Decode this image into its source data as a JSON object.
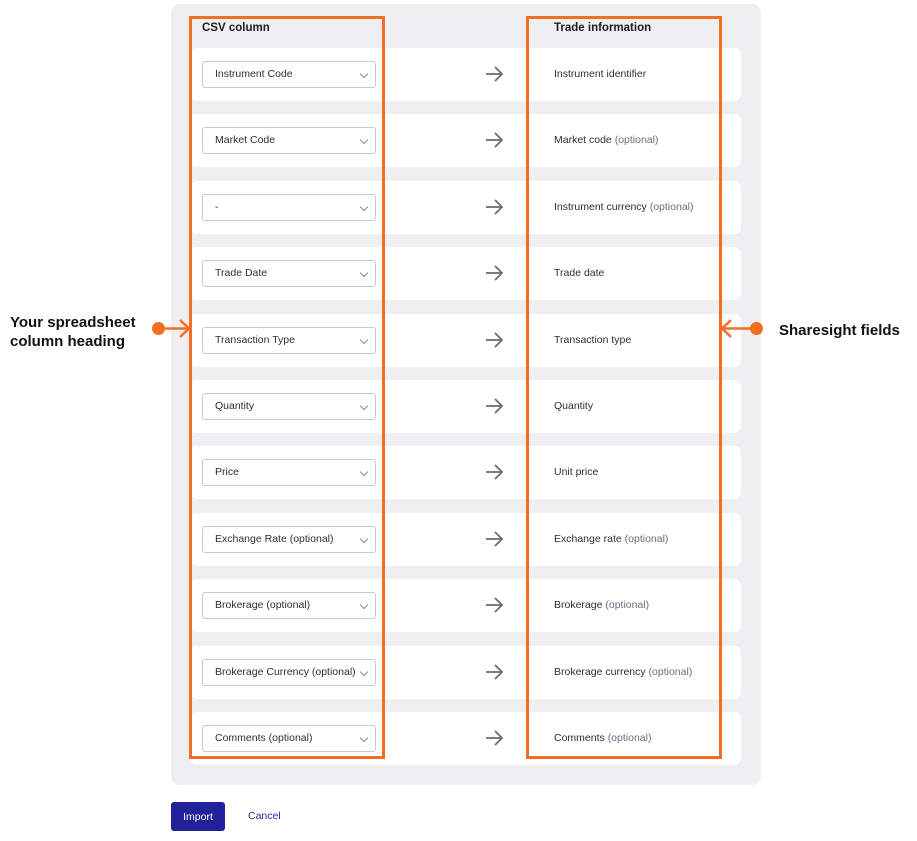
{
  "headers": {
    "csv_column": "CSV column",
    "trade_information": "Trade information"
  },
  "rows": [
    {
      "csv_value": "Instrument Code",
      "field": "Instrument identifier",
      "optional": ""
    },
    {
      "csv_value": "Market Code",
      "field": "Market code",
      "optional": "(optional)"
    },
    {
      "csv_value": "-",
      "field": "Instrument currency",
      "optional": "(optional)"
    },
    {
      "csv_value": "Trade Date",
      "field": "Trade date",
      "optional": ""
    },
    {
      "csv_value": "Transaction Type",
      "field": "Transaction type",
      "optional": ""
    },
    {
      "csv_value": "Quantity",
      "field": "Quantity",
      "optional": ""
    },
    {
      "csv_value": "Price",
      "field": "Unit price",
      "optional": ""
    },
    {
      "csv_value": "Exchange Rate (optional)",
      "field": "Exchange rate",
      "optional": "(optional)"
    },
    {
      "csv_value": "Brokerage (optional)",
      "field": "Brokerage",
      "optional": "(optional)"
    },
    {
      "csv_value": "Brokerage Currency (optional)",
      "field": "Brokerage currency",
      "optional": "(optional)"
    },
    {
      "csv_value": "Comments (optional)",
      "field": "Comments",
      "optional": "(optional)"
    }
  ],
  "annotations": {
    "left_line1": "Your spreadsheet",
    "left_line2": "column heading",
    "right": "Sharesight fields",
    "highlight_color": "#f26e22"
  },
  "actions": {
    "import_label": "Import",
    "cancel_label": "Cancel"
  },
  "icons": {
    "row_arrow": "arrow-right-icon",
    "select_chevron": "chevron-down-icon"
  }
}
